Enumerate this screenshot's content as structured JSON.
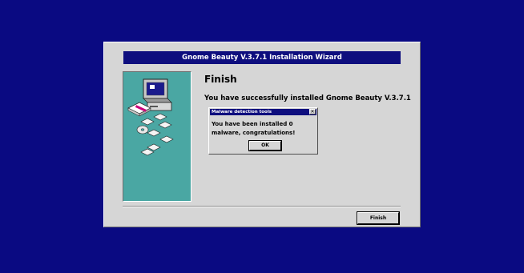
{
  "wizard": {
    "title": "Gnome Beauty V.3.7.1 Installation Wizard",
    "heading": "Finish",
    "success_message": "You have successfully installed Gnome Beauty V.3.7.1",
    "finish_label": "Finish"
  },
  "dialog": {
    "title": "Malware detection tools",
    "close_glyph": "✕",
    "message_line1": "You have been installed 0",
    "message_line2": "malware, congratulations!",
    "ok_label": "OK"
  },
  "colors": {
    "desktop": "#0a0a82",
    "titlebar": "#0e0e7e",
    "window": "#d6d6d6",
    "side_panel": "#4aa7a3"
  },
  "icons": {
    "side_panel_art": "computer-with-disks-icon"
  }
}
